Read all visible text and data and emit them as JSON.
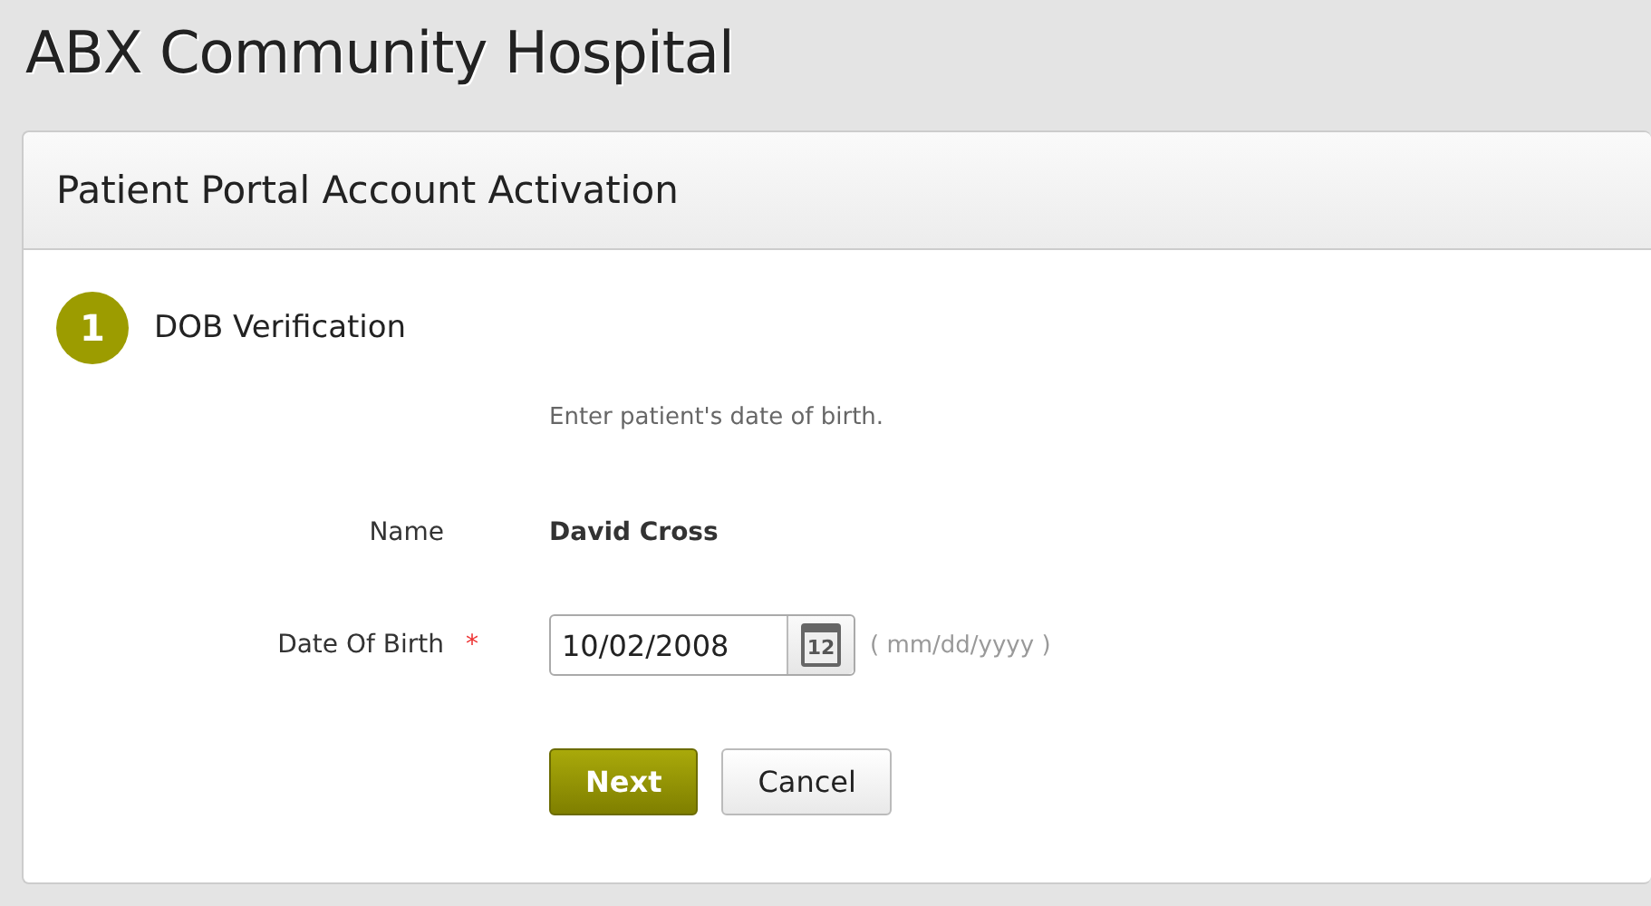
{
  "site_title": "ABX Community Hospital",
  "panel": {
    "title": "Patient Portal Account Activation",
    "step": {
      "number": "1",
      "title": "DOB Verification"
    },
    "instruction": "Enter patient's date of birth.",
    "fields": [
      {
        "kind": "static",
        "label": "Name",
        "value": "David Cross"
      },
      {
        "kind": "date",
        "label": "Date Of Birth",
        "required_mark": "*",
        "value": "10/02/2008",
        "icon_day": "12",
        "hint": "( mm/dd/yyyy )"
      }
    ],
    "buttons": [
      {
        "label": "Next",
        "primary": true
      },
      {
        "label": "Cancel",
        "primary": false
      }
    ]
  }
}
